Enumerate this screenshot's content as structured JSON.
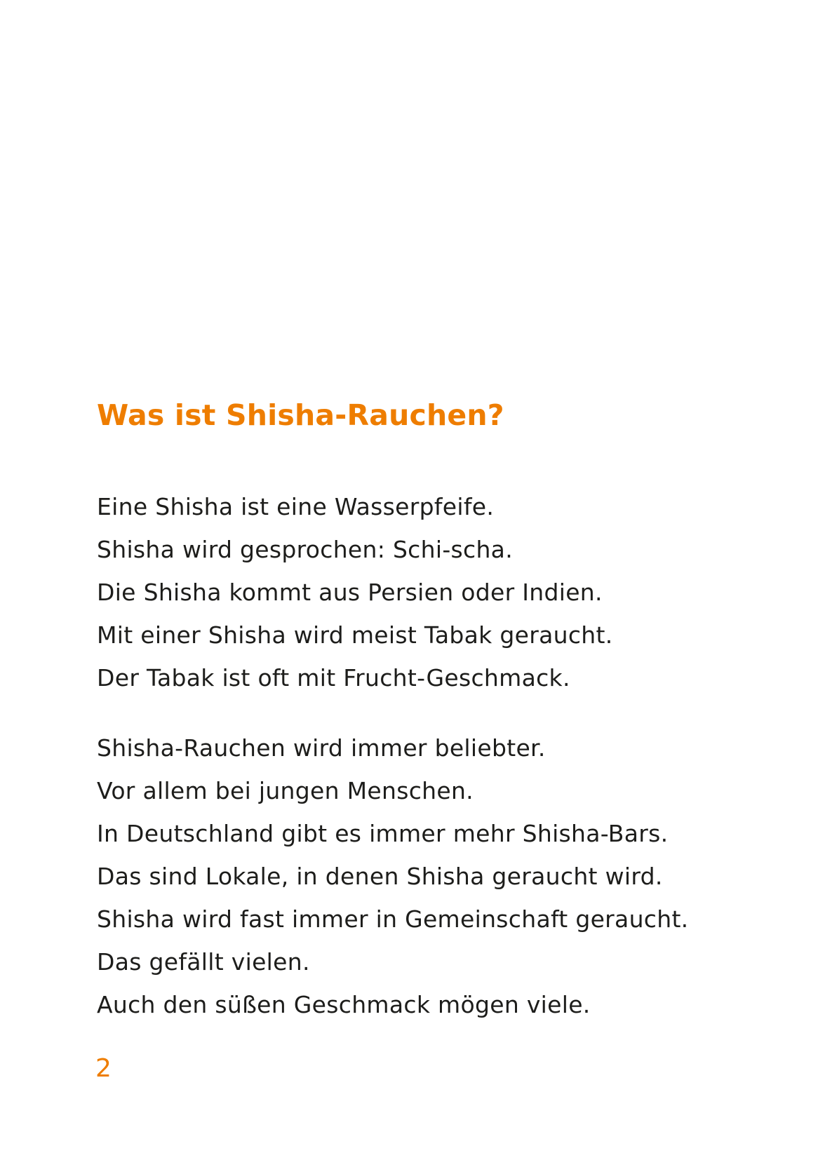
{
  "heading": "Was ist Shisha-Rauchen?",
  "paragraphs": [
    {
      "lines": [
        "Eine Shisha ist eine Wasserpfeife.",
        "Shisha wird gesprochen: Schi-scha.",
        "Die Shisha kommt aus Persien oder Indien.",
        "Mit einer Shisha wird meist Tabak geraucht.",
        "Der Tabak ist oft mit Frucht-Geschmack."
      ]
    },
    {
      "lines": [
        "Shisha-Rauchen wird immer beliebter.",
        "Vor allem bei jungen Menschen.",
        "In Deutschland gibt es immer mehr Shisha-Bars.",
        "Das sind Lokale, in denen Shisha geraucht wird.",
        "Shisha wird fast immer in Gemeinschaft geraucht.",
        "Das gefällt vielen.",
        "Auch den süßen Geschmack mögen viele."
      ]
    }
  ],
  "page_number": "2",
  "colors": {
    "accent": "#ee7d00",
    "text": "#1d1d1b",
    "background": "#ffffff"
  }
}
